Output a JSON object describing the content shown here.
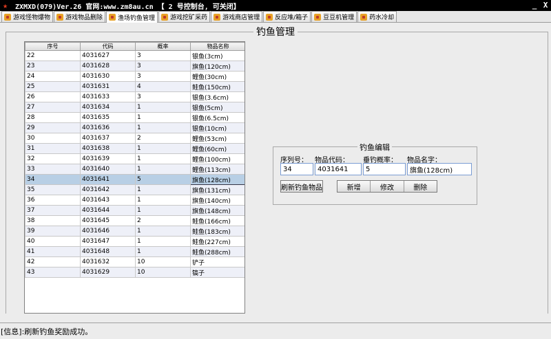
{
  "window": {
    "title": "ZXMXD(079)Ver.26 官网:www.zm8au.cn 【 2 号控制台, 可关闭】",
    "minimize": "_",
    "close": "X"
  },
  "tabs": [
    {
      "label": "游戏怪物爆物",
      "active": false
    },
    {
      "label": "游戏物品删除",
      "active": false
    },
    {
      "label": "渔场钓鱼管理",
      "active": true
    },
    {
      "label": "游戏挖矿采药",
      "active": false
    },
    {
      "label": "游戏商店管理",
      "active": false
    },
    {
      "label": "反应堆/箱子",
      "active": false
    },
    {
      "label": "豆豆机管理",
      "active": false
    },
    {
      "label": "药水冷却",
      "active": false
    }
  ],
  "panel": {
    "title": "钓鱼管理"
  },
  "table": {
    "columns": [
      "序号",
      "代码",
      "概率",
      "物品名称"
    ],
    "selected_index": 12,
    "rows": [
      [
        "22",
        "4031627",
        "3",
        "银鱼(3cm)"
      ],
      [
        "23",
        "4031628",
        "3",
        "旗鱼(120cm)"
      ],
      [
        "24",
        "4031630",
        "3",
        "鲤鱼(30cm)"
      ],
      [
        "25",
        "4031631",
        "4",
        "鲑鱼(150cm)"
      ],
      [
        "26",
        "4031633",
        "3",
        "银鱼(3.6cm)"
      ],
      [
        "27",
        "4031634",
        "1",
        "银鱼(5cm)"
      ],
      [
        "28",
        "4031635",
        "1",
        "银鱼(6.5cm)"
      ],
      [
        "29",
        "4031636",
        "1",
        "银鱼(10cm)"
      ],
      [
        "30",
        "4031637",
        "2",
        "鲤鱼(53cm)"
      ],
      [
        "31",
        "4031638",
        "1",
        "鲤鱼(60cm)"
      ],
      [
        "32",
        "4031639",
        "1",
        "鲤鱼(100cm)"
      ],
      [
        "33",
        "4031640",
        "1",
        "鲤鱼(113cm)"
      ],
      [
        "34",
        "4031641",
        "5",
        "旗鱼(128cm)"
      ],
      [
        "35",
        "4031642",
        "1",
        "旗鱼(131cm)"
      ],
      [
        "36",
        "4031643",
        "1",
        "旗鱼(140cm)"
      ],
      [
        "37",
        "4031644",
        "1",
        "旗鱼(148cm)"
      ],
      [
        "38",
        "4031645",
        "2",
        "鲑鱼(166cm)"
      ],
      [
        "39",
        "4031646",
        "1",
        "鲑鱼(183cm)"
      ],
      [
        "40",
        "4031647",
        "1",
        "鲑鱼(227cm)"
      ],
      [
        "41",
        "4031648",
        "1",
        "鲑鱼(288cm)"
      ],
      [
        "42",
        "4031632",
        "10",
        "铲子"
      ],
      [
        "43",
        "4031629",
        "10",
        "镐子"
      ]
    ]
  },
  "editor": {
    "title": "钓鱼编辑",
    "labels": {
      "seq": "序列号：",
      "code": "物品代码：",
      "prob": "垂钓概率：",
      "name": "物品名字："
    },
    "values": {
      "seq": "34",
      "code": "4031641",
      "prob": "5",
      "name": "旗鱼(128cm)"
    },
    "buttons": {
      "refresh": "刷新钓鱼物品",
      "add": "新增",
      "edit": "修改",
      "delete": "删除"
    }
  },
  "status": {
    "text": "[信息]:刷新钓鱼奖励成功。"
  },
  "colors": {
    "titlebar": "#000000",
    "selected_row": "#b8cfe5",
    "alt_row": "#eef0f8"
  }
}
